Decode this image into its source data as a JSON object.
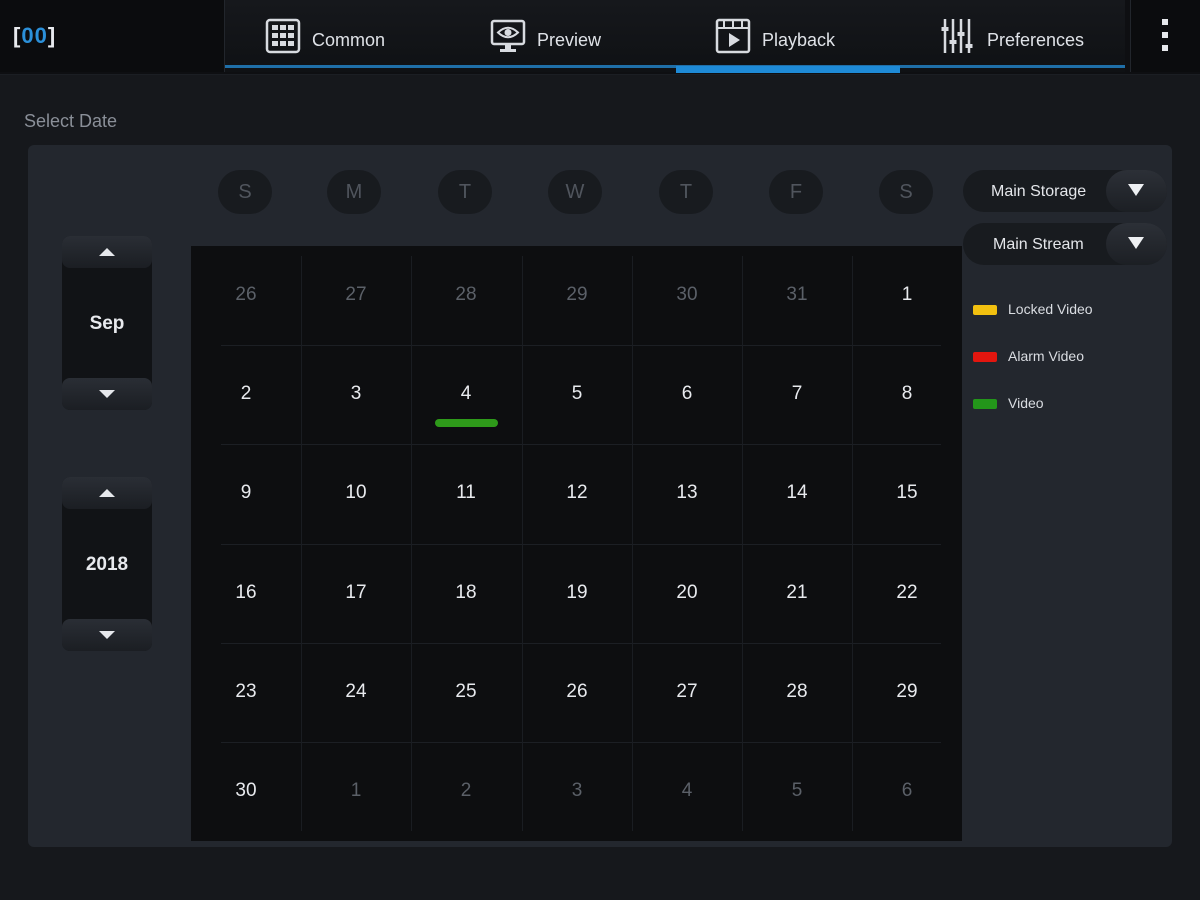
{
  "app": {
    "logo_left": "[",
    "logo_mid": "00",
    "logo_right": "]"
  },
  "tabs": [
    {
      "label": "Common",
      "icon": "grid-icon",
      "active": false
    },
    {
      "label": "Preview",
      "icon": "monitor-eye-icon",
      "active": false
    },
    {
      "label": "Playback",
      "icon": "film-play-icon",
      "active": true
    },
    {
      "label": "Preferences",
      "icon": "sliders-icon",
      "active": false
    }
  ],
  "menu_icon": "more-vertical-icon",
  "page_title": "Select Date",
  "month_spinner": {
    "value": "Sep"
  },
  "year_spinner": {
    "value": "2018"
  },
  "weekdays": [
    "S",
    "M",
    "T",
    "W",
    "T",
    "F",
    "S"
  ],
  "calendar": {
    "weeks": [
      [
        {
          "d": "26",
          "cur": false
        },
        {
          "d": "27",
          "cur": false
        },
        {
          "d": "28",
          "cur": false
        },
        {
          "d": "29",
          "cur": false
        },
        {
          "d": "30",
          "cur": false
        },
        {
          "d": "31",
          "cur": false
        },
        {
          "d": "1",
          "cur": true
        }
      ],
      [
        {
          "d": "2",
          "cur": true
        },
        {
          "d": "3",
          "cur": true
        },
        {
          "d": "4",
          "cur": true,
          "record": "video"
        },
        {
          "d": "5",
          "cur": true
        },
        {
          "d": "6",
          "cur": true
        },
        {
          "d": "7",
          "cur": true
        },
        {
          "d": "8",
          "cur": true
        }
      ],
      [
        {
          "d": "9",
          "cur": true
        },
        {
          "d": "10",
          "cur": true
        },
        {
          "d": "11",
          "cur": true
        },
        {
          "d": "12",
          "cur": true
        },
        {
          "d": "13",
          "cur": true
        },
        {
          "d": "14",
          "cur": true
        },
        {
          "d": "15",
          "cur": true
        }
      ],
      [
        {
          "d": "16",
          "cur": true
        },
        {
          "d": "17",
          "cur": true
        },
        {
          "d": "18",
          "cur": true
        },
        {
          "d": "19",
          "cur": true
        },
        {
          "d": "20",
          "cur": true
        },
        {
          "d": "21",
          "cur": true
        },
        {
          "d": "22",
          "cur": true
        }
      ],
      [
        {
          "d": "23",
          "cur": true
        },
        {
          "d": "24",
          "cur": true
        },
        {
          "d": "25",
          "cur": true
        },
        {
          "d": "26",
          "cur": true
        },
        {
          "d": "27",
          "cur": true
        },
        {
          "d": "28",
          "cur": true
        },
        {
          "d": "29",
          "cur": true
        }
      ],
      [
        {
          "d": "30",
          "cur": true
        },
        {
          "d": "1",
          "cur": false
        },
        {
          "d": "2",
          "cur": false
        },
        {
          "d": "3",
          "cur": false
        },
        {
          "d": "4",
          "cur": false
        },
        {
          "d": "5",
          "cur": false
        },
        {
          "d": "6",
          "cur": false
        }
      ]
    ]
  },
  "storage_select": {
    "value": "Main Storage"
  },
  "stream_select": {
    "value": "Main Stream"
  },
  "legend": [
    {
      "label": "Locked Video",
      "color": "#f2c00f"
    },
    {
      "label": "Alarm Video",
      "color": "#e3160f"
    },
    {
      "label": "Video",
      "color": "#23961a"
    }
  ],
  "colors": {
    "accent": "#1e8ad6",
    "record_video": "#2e9a1a"
  }
}
